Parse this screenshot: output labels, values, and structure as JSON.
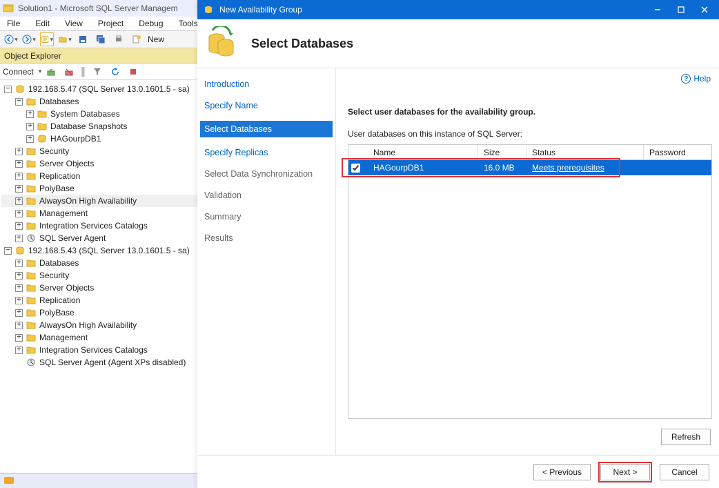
{
  "ssms": {
    "title": "Solution1 - Microsoft SQL Server Managem",
    "menu": [
      "File",
      "Edit",
      "View",
      "Project",
      "Debug",
      "Tools"
    ],
    "new_label": "New",
    "object_explorer": "Object Explorer",
    "connect_label": "Connect",
    "servers": [
      {
        "label": "192.168.5.47 (SQL Server 13.0.1601.5 - sa)",
        "children": [
          {
            "label": "Databases",
            "children": [
              {
                "label": "System Databases"
              },
              {
                "label": "Database Snapshots"
              },
              {
                "label": "HAGourpDB1",
                "icon": "db"
              }
            ]
          },
          {
            "label": "Security"
          },
          {
            "label": "Server Objects"
          },
          {
            "label": "Replication"
          },
          {
            "label": "PolyBase"
          },
          {
            "label": "AlwaysOn High Availability",
            "selected": true
          },
          {
            "label": "Management"
          },
          {
            "label": "Integration Services Catalogs"
          },
          {
            "label": "SQL Server Agent",
            "icon": "agent"
          }
        ]
      },
      {
        "label": "192.168.5.43 (SQL Server 13.0.1601.5 - sa)",
        "children": [
          {
            "label": "Databases"
          },
          {
            "label": "Security"
          },
          {
            "label": "Server Objects"
          },
          {
            "label": "Replication"
          },
          {
            "label": "PolyBase"
          },
          {
            "label": "AlwaysOn High Availability"
          },
          {
            "label": "Management"
          },
          {
            "label": "Integration Services Catalogs"
          },
          {
            "label": "SQL Server Agent (Agent XPs disabled)",
            "icon": "agent"
          }
        ]
      }
    ]
  },
  "wizard": {
    "window_title": "New Availability Group",
    "page_title": "Select Databases",
    "help": "Help",
    "steps": [
      "Introduction",
      "Specify Name",
      "Select Databases",
      "Specify Replicas",
      "Select Data Synchronization",
      "Validation",
      "Summary",
      "Results"
    ],
    "active_step_index": 2,
    "main": {
      "heading": "Select user databases for the availability group.",
      "subheading": "User databases on this instance of SQL Server:",
      "columns": {
        "name": "Name",
        "size": "Size",
        "status": "Status",
        "password": "Password"
      },
      "rows": [
        {
          "checked": true,
          "name": "HAGourpDB1",
          "size": "16.0 MB",
          "status": "Meets prerequisites"
        }
      ],
      "refresh": "Refresh"
    },
    "buttons": {
      "prev": "< Previous",
      "next": "Next >",
      "cancel": "Cancel"
    }
  }
}
